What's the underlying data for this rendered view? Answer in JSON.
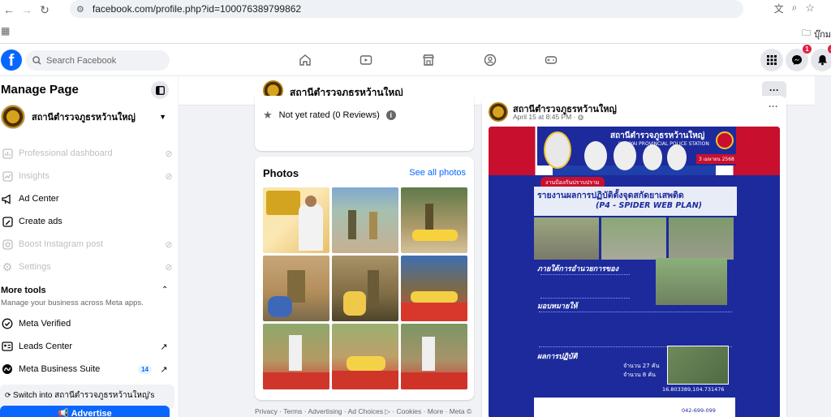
{
  "browser": {
    "url": "facebook.com/profile.php?id=100076389799862",
    "bookmark_folder": "บุ๊กม"
  },
  "fb": {
    "search_placeholder": "Search Facebook",
    "messenger_badge": "1",
    "notifications_badge": "4"
  },
  "sidebar": {
    "title": "Manage Page",
    "page_name": "สถานีตำรวจภูธรหว้านใหญ่",
    "items": [
      {
        "label": "Professional dashboard"
      },
      {
        "label": "Insights"
      },
      {
        "label": "Ad Center"
      },
      {
        "label": "Create ads"
      },
      {
        "label": "Boost Instagram post"
      },
      {
        "label": "Settings"
      }
    ],
    "more_tools": "More tools",
    "more_tools_sub": "Manage your business across Meta apps.",
    "tools": [
      {
        "label": "Meta Verified"
      },
      {
        "label": "Leads Center"
      },
      {
        "label": "Meta Business Suite",
        "count": "14"
      }
    ],
    "switch_text": "Switch into สถานีตำรวจภูธรหว้านใหญ่'s",
    "advertise": "Advertise"
  },
  "header": {
    "page_name": "สถานีตำรวจภูธรหว้านใหญ่"
  },
  "rating": {
    "text": "Not yet rated (0 Reviews)"
  },
  "photos": {
    "title": "Photos",
    "see_all": "See all photos"
  },
  "footer": "Privacy · Terms · Advertising · Ad Choices ▷ · Cookies · More · Meta ©",
  "post": {
    "author": "สถานีตำรวจภูธรหว้านใหญ่",
    "date": "April 15 at 8:45 PM",
    "poster": {
      "station": "สถานีตำรวจภูธรหว้านใหญ่",
      "station_en": "WANYAI PROVINCIAL POLICE STATION",
      "date": "3 เมษายน 2568",
      "tag": "งานป้องกันปราบปราม",
      "headline": "รายงานผลการปฏิบัติตั้งจุดสกัดยาเสพติด",
      "plan": "(P4 - SPIDER WEB PLAN)",
      "under": "ภายใต้การอำนวยการของ",
      "assign": "มอบหมายให้",
      "result": "ผลการปฏิบัติ",
      "cars": "จำนวน 27 คัน",
      "bikes": "จำนวน 8 คัน",
      "coords": "16.803389,104.731476",
      "phone": "042-699-099"
    }
  }
}
